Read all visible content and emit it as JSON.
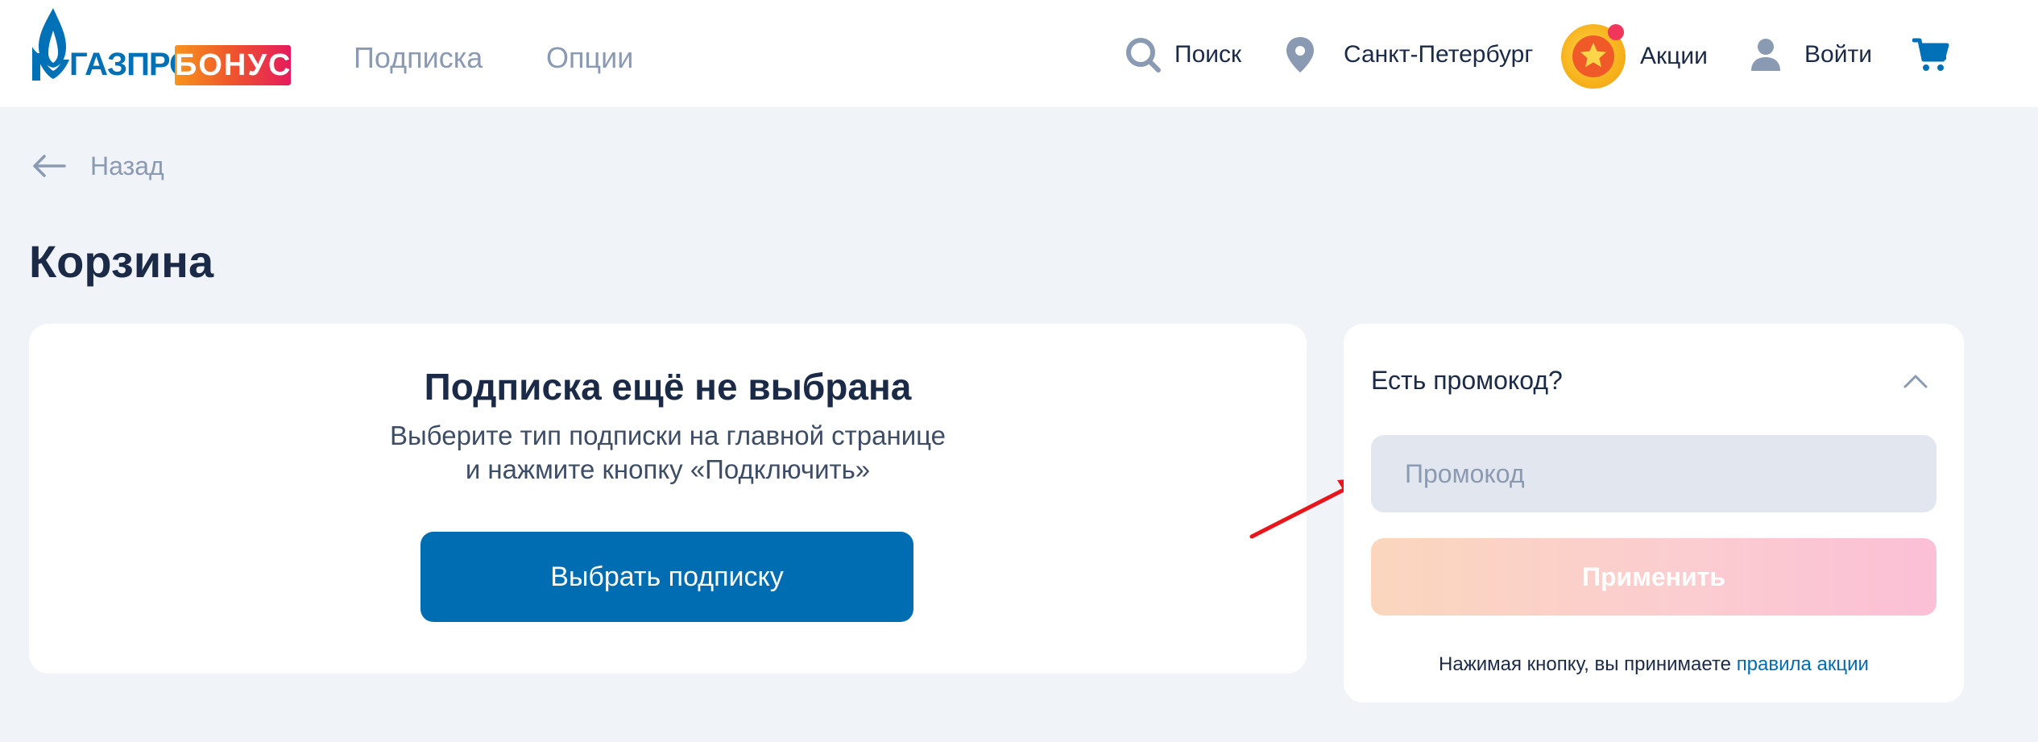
{
  "header": {
    "logo": {
      "brand": "ГАЗПРОМ",
      "bonus": "БОНУС"
    },
    "nav": [
      {
        "label": "Подписка"
      },
      {
        "label": "Опции"
      }
    ],
    "search_label": "Поиск",
    "city_label": "Санкт-Петербург",
    "promo_label": "Акции",
    "login_label": "Войти",
    "icons": {
      "search": "search-icon",
      "city": "location-pin-icon",
      "promo": "star-coin-icon",
      "login": "user-icon",
      "cart": "cart-icon"
    }
  },
  "back": {
    "label": "Назад"
  },
  "page_title": "Корзина",
  "empty_cart": {
    "title": "Подписка ещё не выбрана",
    "desc_line1": "Выберите тип подписки на главной странице",
    "desc_line2": "и нажмите кнопку «Подключить»",
    "button_label": "Выбрать подписку"
  },
  "promo": {
    "heading": "Есть промокод?",
    "placeholder": "Промокод",
    "value": "",
    "apply_label": "Применить",
    "terms_text": "Нажимая кнопку, вы принимаете",
    "terms_link": "правила акции"
  },
  "colors": {
    "accent": "#006cb2",
    "background": "#f0f3f8",
    "annotation_arrow": "#e8161b"
  }
}
